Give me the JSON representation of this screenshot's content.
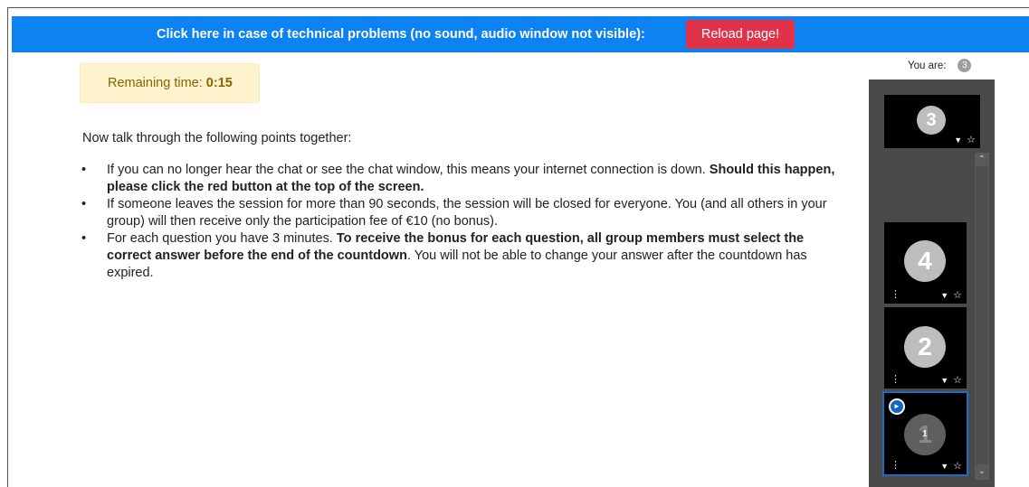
{
  "banner": {
    "text": "Click here in case of technical problems (no sound, audio window not visible):",
    "button_label": "Reload page!"
  },
  "timer": {
    "label": "Remaining time:",
    "value": "0:15"
  },
  "content": {
    "intro": "Now talk through the following points together:",
    "bullet_char": "•",
    "points": [
      {
        "text1": "If you can no longer hear the chat or see the chat window, this means your internet connection is down. ",
        "bold1": "Should this happen, please click the red button at the top of the screen."
      },
      {
        "text1": "If someone leaves the session for more than 90 seconds, the session will be closed for everyone. You (and all others in your group) will then receive only the participation fee of €10 (no bonus)."
      },
      {
        "text1": "For each question you have 3 minutes. ",
        "bold1": "To receive the bonus for each question, all group members must select the correct answer before the end of the countdown",
        "text2": ". You will not be able to change your answer after the countdown has expired."
      }
    ]
  },
  "participants": {
    "you_are_label": "You are:",
    "you_are_number": "3",
    "self_tile": {
      "number": "3"
    },
    "tiles": [
      {
        "number": "4"
      },
      {
        "number": "2"
      },
      {
        "number": "1",
        "small_number": "1"
      }
    ],
    "icons": {
      "camera_off": "camera-off-icon",
      "star": "star-icon",
      "menu": "menu-dots-icon",
      "speaking": "speaking-icon"
    }
  }
}
